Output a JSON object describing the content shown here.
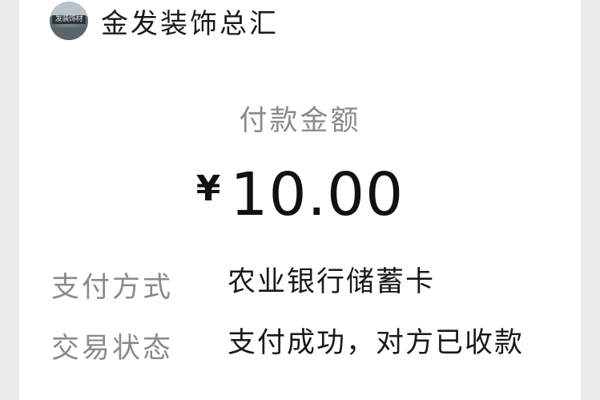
{
  "merchant": {
    "avatar_sign_text": "发装饰材",
    "name": "金发装饰总汇"
  },
  "payment": {
    "amount_label": "付款金额",
    "currency_symbol": "¥",
    "amount": "10.00"
  },
  "details": [
    {
      "label": "支付方式",
      "value": "农业银行储蓄卡"
    },
    {
      "label": "交易状态",
      "value": "支付成功，对方已收款"
    }
  ]
}
